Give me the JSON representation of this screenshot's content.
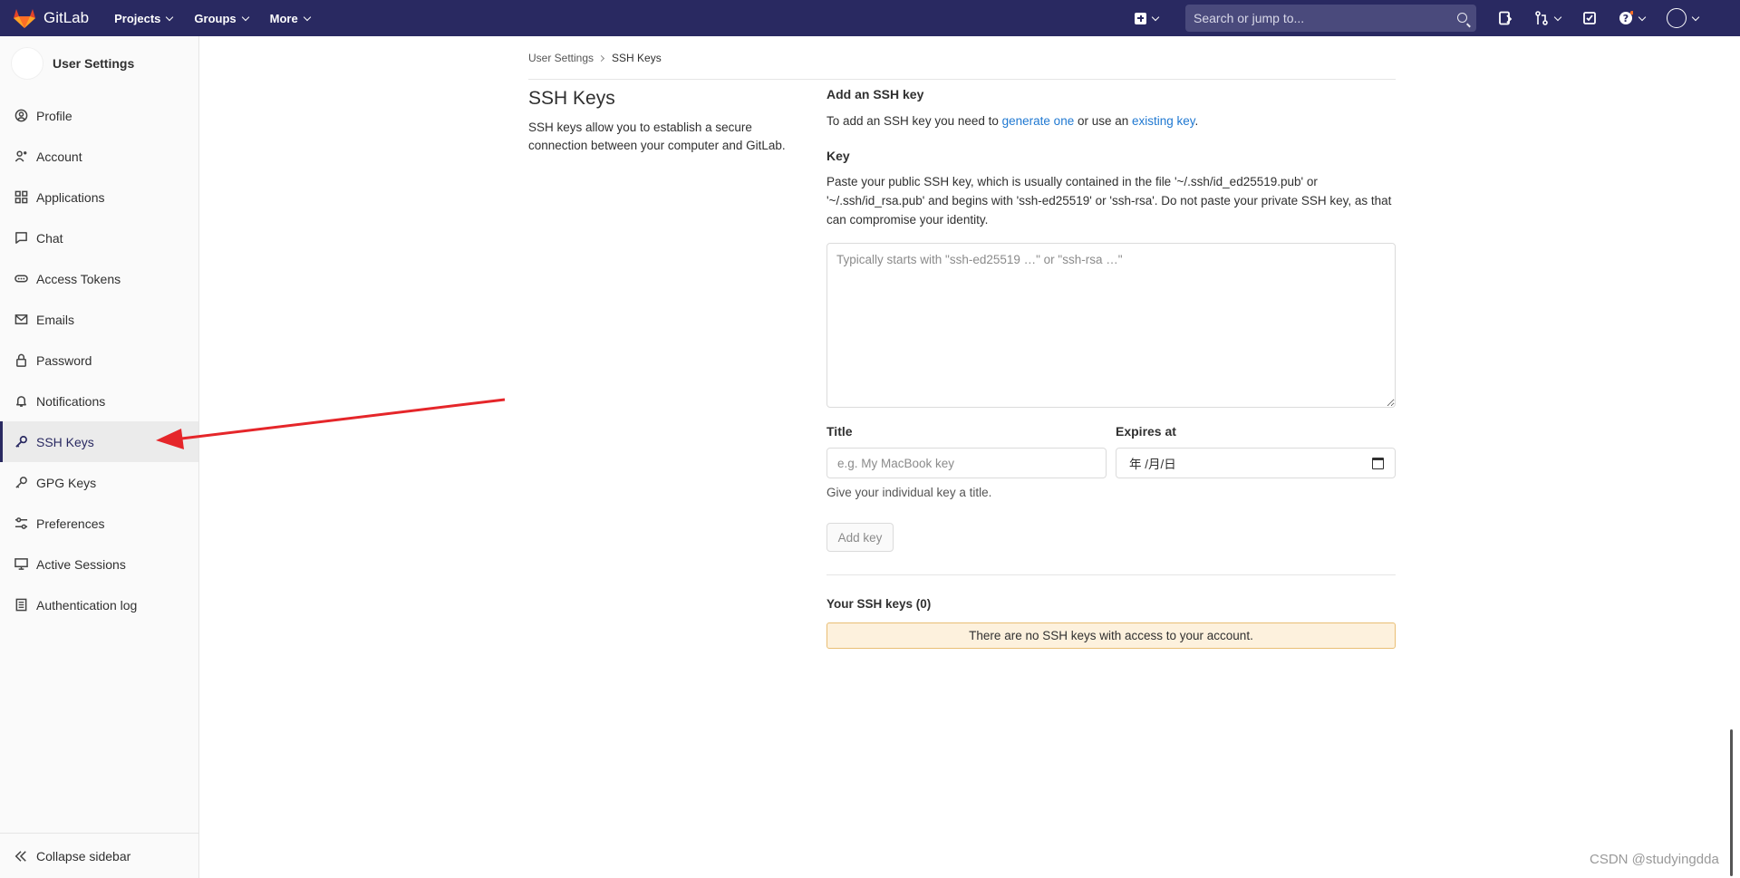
{
  "topnav": {
    "brand": "GitLab",
    "menu": [
      {
        "label": "Projects"
      },
      {
        "label": "Groups"
      },
      {
        "label": "More"
      }
    ],
    "search_placeholder": "Search or jump to..."
  },
  "sidebar": {
    "title": "User Settings",
    "items": [
      {
        "label": "Profile",
        "icon": "profile-icon"
      },
      {
        "label": "Account",
        "icon": "account-icon"
      },
      {
        "label": "Applications",
        "icon": "applications-icon"
      },
      {
        "label": "Chat",
        "icon": "chat-icon"
      },
      {
        "label": "Access Tokens",
        "icon": "token-icon"
      },
      {
        "label": "Emails",
        "icon": "mail-icon"
      },
      {
        "label": "Password",
        "icon": "lock-icon"
      },
      {
        "label": "Notifications",
        "icon": "bell-icon"
      },
      {
        "label": "SSH Keys",
        "icon": "key-icon",
        "active": true
      },
      {
        "label": "GPG Keys",
        "icon": "key-icon"
      },
      {
        "label": "Preferences",
        "icon": "preferences-icon"
      },
      {
        "label": "Active Sessions",
        "icon": "monitor-icon"
      },
      {
        "label": "Authentication log",
        "icon": "log-icon"
      }
    ],
    "collapse_label": "Collapse sidebar"
  },
  "breadcrumb": {
    "parent": "User Settings",
    "current": "SSH Keys"
  },
  "intro": {
    "title": "SSH Keys",
    "description": "SSH keys allow you to establish a secure connection between your computer and GitLab."
  },
  "form": {
    "heading": "Add an SSH key",
    "info_prefix": "To add an SSH key you need to ",
    "info_link1": "generate one",
    "info_middle": " or use an ",
    "info_link2": "existing key",
    "info_suffix": ".",
    "key_label": "Key",
    "key_help": "Paste your public SSH key, which is usually contained in the file '~/.ssh/id_ed25519.pub' or '~/.ssh/id_rsa.pub' and begins with 'ssh-ed25519' or 'ssh-rsa'. Do not paste your private SSH key, as that can compromise your identity.",
    "key_placeholder": "Typically starts with \"ssh-ed25519 …\" or \"ssh-rsa …\"",
    "title_label": "Title",
    "title_placeholder": "e.g. My MacBook key",
    "expires_label": "Expires at",
    "expires_value": "年 /月/日",
    "title_help": "Give your individual key a title.",
    "add_button": "Add key"
  },
  "keys": {
    "heading": "Your SSH keys (0)",
    "empty_message": "There are no SSH keys with access to your account."
  },
  "watermark": "CSDN @studyingdda",
  "colors": {
    "nav_bg": "#292961",
    "link": "#1f78d1",
    "alert_bg": "#fdf1dd",
    "alert_border": "#e9be74",
    "arrow": "#e5262a"
  }
}
